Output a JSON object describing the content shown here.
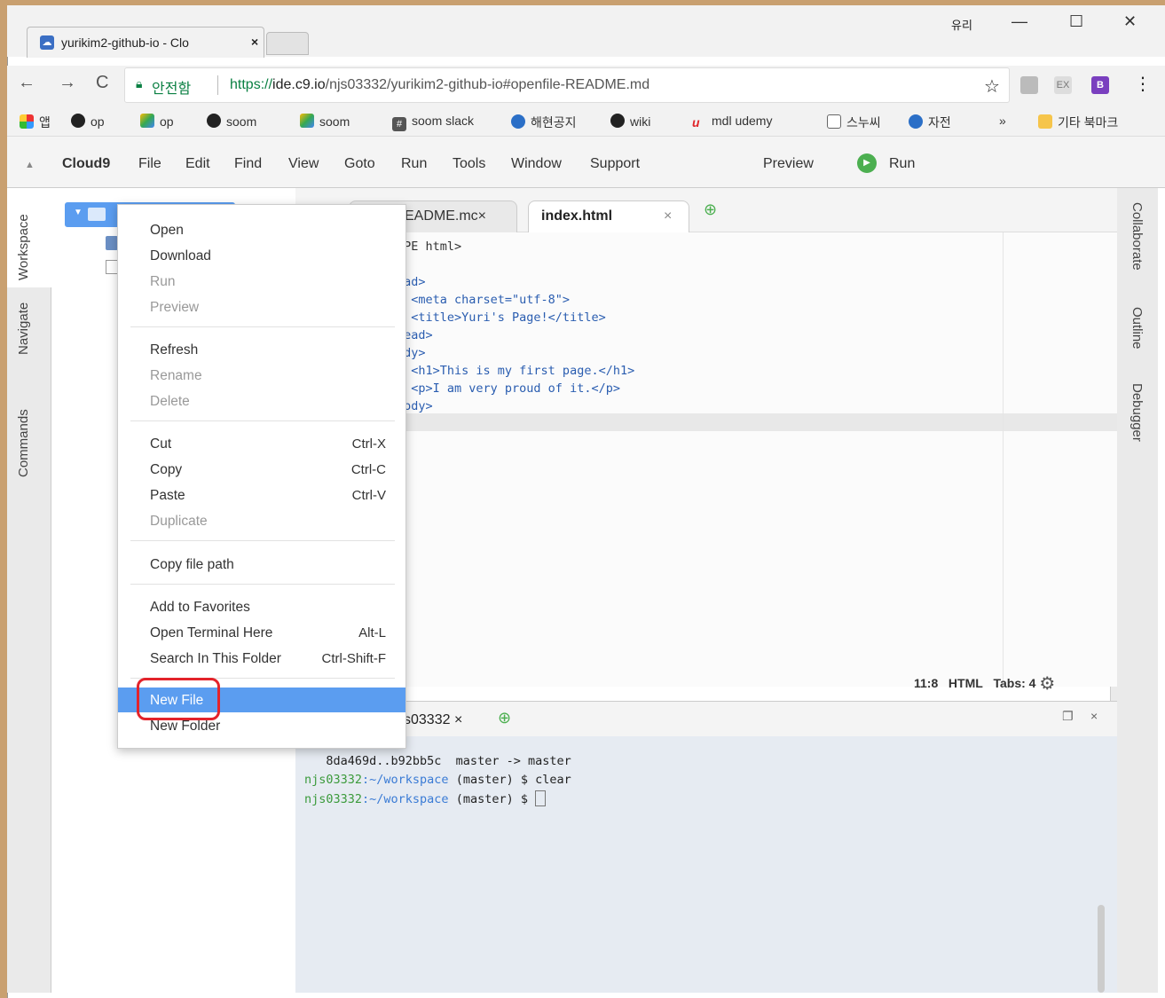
{
  "browser": {
    "tab_title": "yurikim2-github-io - Clo",
    "tab_close": "×",
    "user_label": "유리",
    "window_buttons": {
      "minimize": "—",
      "maximize": "☐",
      "close": "✕"
    },
    "back": "←",
    "forward": "→",
    "reload": "C",
    "secure_label": "안전함",
    "url_proto": "https://",
    "url_host": "ide.c9.io",
    "url_path": "/njs03332/yurikim2-github-io#openfile-README.md",
    "star": "☆",
    "menu_dots": "⋮",
    "ext_ex": "EX",
    "ext_b": "B"
  },
  "bookmarks": [
    {
      "label": "앱",
      "icon": "apps-icon"
    },
    {
      "label": "op",
      "icon": "github-icon"
    },
    {
      "label": "op",
      "icon": "google-drive-icon"
    },
    {
      "label": "soom",
      "icon": "github-icon"
    },
    {
      "label": "soom",
      "icon": "google-drive-icon"
    },
    {
      "label": "soom slack",
      "icon": "slack-icon"
    },
    {
      "label": "해현공지",
      "icon": "bookmark-icon"
    },
    {
      "label": "wiki",
      "icon": "github-icon"
    },
    {
      "label": "mdl udemy",
      "icon": "udemy-icon"
    },
    {
      "label": "스누씨",
      "icon": "page-icon"
    },
    {
      "label": "자전",
      "icon": "bookmark-icon"
    },
    {
      "label": "»",
      "icon": ""
    },
    {
      "label": "기타 북마크",
      "icon": "folder-icon"
    }
  ],
  "c9menu": {
    "brand": "Cloud9",
    "items": [
      "File",
      "Edit",
      "Find",
      "View",
      "Goto",
      "Run",
      "Tools",
      "Window",
      "Support"
    ],
    "preview": "Preview",
    "run": "Run"
  },
  "sidebars": {
    "left": [
      "Workspace",
      "Navigate",
      "Commands"
    ],
    "right": [
      "Collaborate",
      "Outline",
      "Debugger"
    ]
  },
  "editor": {
    "tabs": [
      {
        "label": "EADME.mc×",
        "active": false
      },
      {
        "label": "index.html",
        "active": true
      }
    ],
    "tab_close": "×",
    "add_tab": "⊕",
    "lines": [
      "YPE html>",
      "",
      "ead>",
      "  <meta charset=\"utf-8\">",
      "  <title>Yuri's Page!</title>",
      "head>",
      "ody>",
      "  <h1>This is my first page.</h1>",
      "  <p>I am very proud of it.</p>",
      "body>",
      ">"
    ],
    "status": {
      "position": "11:8",
      "mode": "HTML",
      "tabs": "Tabs: 4"
    }
  },
  "terminal": {
    "tab_label": "s03332 ×",
    "add_tab": "⊕",
    "lines": [
      "   8da469d..b92bb5c  master -> master"
    ],
    "prompt_user": "njs03332",
    "prompt_path": ":~/workspace",
    "prompt_branch": " (master) $ ",
    "cmd1": "clear",
    "cmd2": ""
  },
  "context_menu": {
    "items": [
      {
        "label": "Open",
        "shortcut": "",
        "disabled": false
      },
      {
        "label": "Download",
        "shortcut": "",
        "disabled": false
      },
      {
        "label": "Run",
        "shortcut": "",
        "disabled": true
      },
      {
        "label": "Preview",
        "shortcut": "",
        "disabled": true
      },
      {
        "label": "Refresh",
        "shortcut": "",
        "disabled": false
      },
      {
        "label": "Rename",
        "shortcut": "",
        "disabled": true
      },
      {
        "label": "Delete",
        "shortcut": "",
        "disabled": true
      },
      {
        "label": "Cut",
        "shortcut": "Ctrl-X",
        "disabled": false
      },
      {
        "label": "Copy",
        "shortcut": "Ctrl-C",
        "disabled": false
      },
      {
        "label": "Paste",
        "shortcut": "Ctrl-V",
        "disabled": false
      },
      {
        "label": "Duplicate",
        "shortcut": "",
        "disabled": true
      },
      {
        "label": "Copy file path",
        "shortcut": "",
        "disabled": false
      },
      {
        "label": "Add to Favorites",
        "shortcut": "",
        "disabled": false
      },
      {
        "label": "Open Terminal Here",
        "shortcut": "Alt-L",
        "disabled": false
      },
      {
        "label": "Search In This Folder",
        "shortcut": "Ctrl-Shift-F",
        "disabled": false
      },
      {
        "label": "New File",
        "shortcut": "",
        "disabled": false,
        "highlighted": true
      },
      {
        "label": "New Folder",
        "shortcut": "",
        "disabled": false
      }
    ]
  },
  "colors": {
    "accent": "#5b9df0",
    "annotation": "#e3232b",
    "secure": "#0b8043"
  }
}
